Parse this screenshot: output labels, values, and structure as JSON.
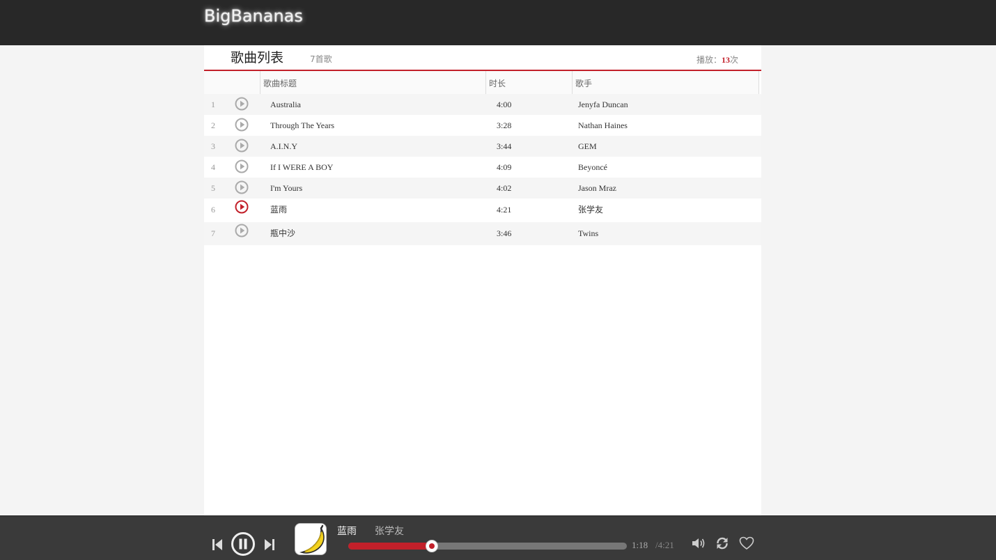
{
  "app": {
    "brand": "BigBananas"
  },
  "playlist": {
    "title": "歌曲列表",
    "count": "7首歌",
    "plays_label": "播放：",
    "plays_count": "13",
    "plays_suffix": "次",
    "columns": {
      "title": "歌曲标题",
      "duration": "时长",
      "artist": "歌手"
    },
    "songs": [
      {
        "index": "1",
        "title": "Australia",
        "duration": "4:00",
        "artist": "Jenyfa Duncan"
      },
      {
        "index": "2",
        "title": "Through The Years",
        "duration": "3:28",
        "artist": "Nathan Haines"
      },
      {
        "index": "3",
        "title": "A.I.N.Y",
        "duration": "3:44",
        "artist": "GEM"
      },
      {
        "index": "4",
        "title": "If I WERE A BOY",
        "duration": "4:09",
        "artist": "Beyoncé"
      },
      {
        "index": "5",
        "title": "I'm Yours",
        "duration": "4:02",
        "artist": "Jason Mraz"
      },
      {
        "index": "6",
        "title": "蓝雨",
        "duration": "4:21",
        "artist": "张学友"
      },
      {
        "index": "7",
        "title": "瓶中沙",
        "duration": "3:46",
        "artist": "Twins"
      }
    ],
    "current_index": 6
  },
  "player": {
    "now_title": "蓝雨",
    "now_artist": "张学友",
    "current_time": "1:18",
    "total_time": "/4:21",
    "progress_fraction": 0.3,
    "icons": [
      "skip-back-icon",
      "pause-icon",
      "skip-forward-icon",
      "volume-icon",
      "repeat-icon",
      "heart-icon",
      "banana-cover-art"
    ]
  },
  "colors": {
    "accent": "#c2202a",
    "topbar": "#282828",
    "playbar": "#3a3a3a"
  }
}
